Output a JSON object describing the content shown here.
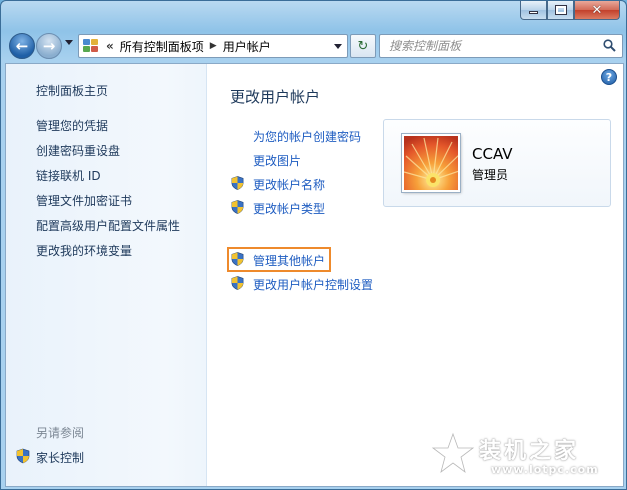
{
  "window": {
    "caption_buttons": {
      "minimize_icon": "minimize-icon",
      "maximize_icon": "maximize-icon",
      "close_glyph": "✕"
    }
  },
  "nav": {
    "back_glyph": "←",
    "forward_glyph": "→",
    "overflow_glyph": "«",
    "breadcrumb": [
      "所有控制面板项",
      "用户帐户"
    ],
    "refresh_glyph": "↻",
    "search_placeholder": "搜索控制面板"
  },
  "sidebar": {
    "home": "控制面板主页",
    "tasks": [
      "管理您的凭据",
      "创建密码重设盘",
      "链接联机 ID",
      "管理文件加密证书",
      "配置高级用户配置文件属性",
      "更改我的环境变量"
    ],
    "see_also_header": "另请参阅",
    "see_also": [
      "家长控制"
    ]
  },
  "main": {
    "title": "更改用户帐户",
    "links": [
      "为您的帐户创建密码",
      "更改图片",
      "更改帐户名称",
      "更改帐户类型"
    ],
    "other_links": [
      "管理其他帐户",
      "更改用户帐户控制设置"
    ],
    "help_glyph": "?"
  },
  "user": {
    "name": "CCAV",
    "role": "管理员"
  },
  "watermark": {
    "text": "装机之家",
    "url": "www.lotpc.com"
  },
  "colors": {
    "link": "#1e5cc1",
    "highlight": "#ee8a2c",
    "nav_text": "#1e395b"
  }
}
